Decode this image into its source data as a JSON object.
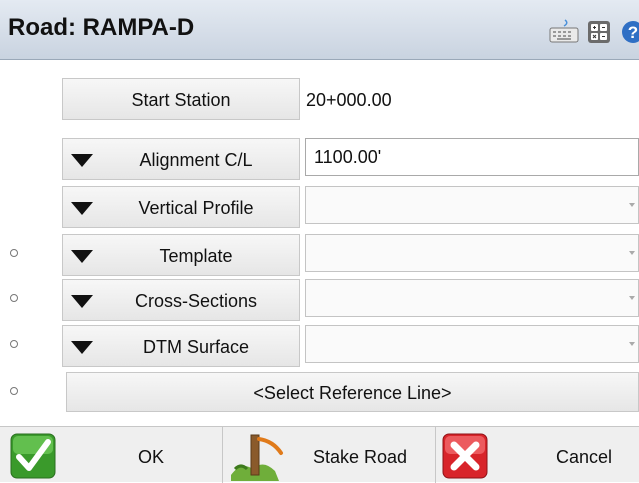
{
  "window": {
    "title": "Road: RAMPA-D"
  },
  "title_icons": [
    "keyboard-icon",
    "calculator-icon",
    "help-icon"
  ],
  "form": {
    "start_station": {
      "label": "Start Station",
      "value": "20+000.00"
    },
    "rows": [
      {
        "label": "Alignment C/L",
        "value": "1100.00'"
      },
      {
        "label": "Vertical Profile",
        "value": ""
      },
      {
        "label": "Template",
        "value": ""
      },
      {
        "label": "Cross-Sections",
        "value": ""
      },
      {
        "label": "DTM Surface",
        "value": ""
      }
    ],
    "reference_line": {
      "label": "<Select Reference Line>"
    }
  },
  "actions": {
    "ok_label": "OK",
    "stake_label": "Stake Road",
    "cancel_label": "Cancel"
  },
  "colors": {
    "title_bar": "#d3dbe6",
    "ok_green": "#3a9a2b",
    "cancel_red": "#d8242a"
  }
}
